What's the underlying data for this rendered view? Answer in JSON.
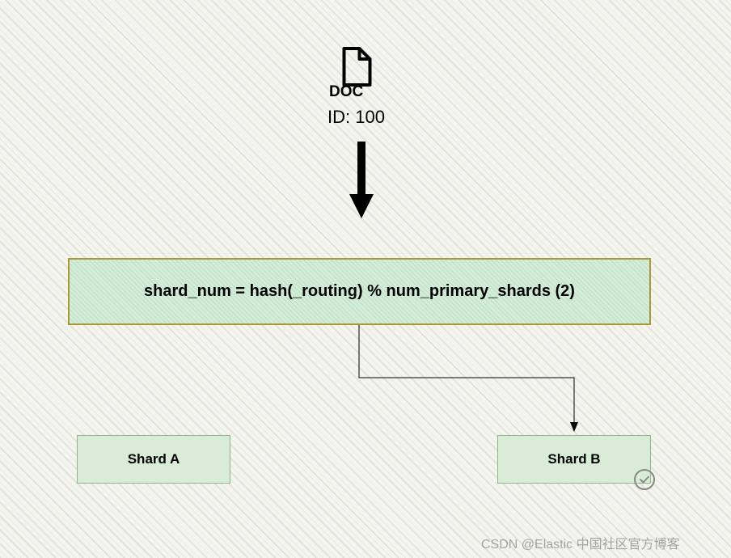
{
  "diagram": {
    "doc_icon_label": "DOC",
    "doc_id_text": "ID: 100",
    "formula_text": "shard_num = hash(_routing) % num_primary_shards (2)",
    "shard_a_label": "Shard A",
    "shard_b_label": "Shard B",
    "watermark_text": "CSDN @Elastic 中国社区官方博客"
  },
  "colors": {
    "formula_bg": "#d4edda",
    "formula_border": "#a89838",
    "shard_bg": "#d8ecd8",
    "shard_border": "#8ab88a"
  }
}
